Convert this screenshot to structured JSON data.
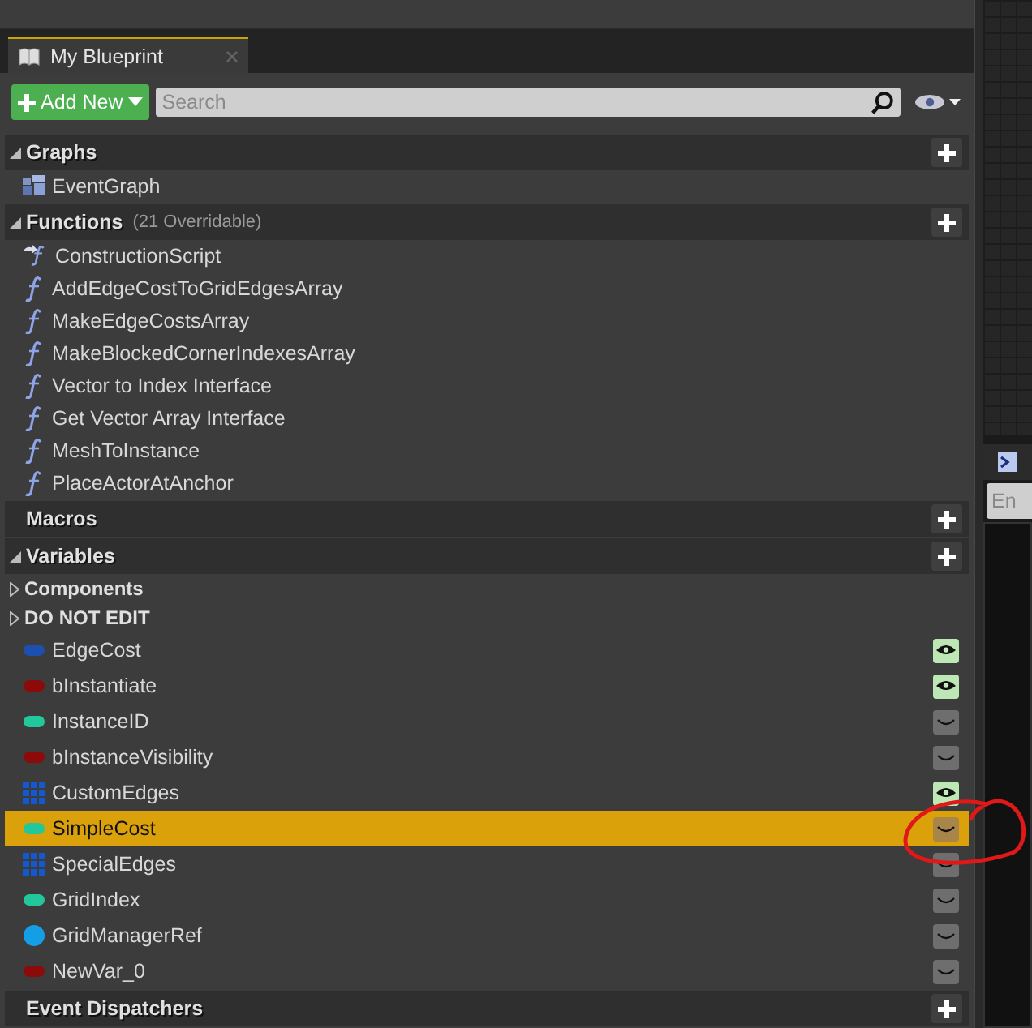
{
  "tab": {
    "title": "My Blueprint"
  },
  "toolbar": {
    "add_button": "Add New",
    "search": {
      "placeholder": "Search"
    }
  },
  "sections": [
    {
      "title": "Graphs",
      "expanded": true,
      "add_button": true,
      "items": [
        {
          "kind": "graph",
          "label": "EventGraph"
        }
      ]
    },
    {
      "title": "Functions",
      "note": "(21 Overridable)",
      "expanded": true,
      "add_button": true,
      "items": [
        {
          "kind": "construction",
          "label": "ConstructionScript"
        },
        {
          "kind": "function",
          "label": "AddEdgeCostToGridEdgesArray"
        },
        {
          "kind": "function",
          "label": "MakeEdgeCostsArray"
        },
        {
          "kind": "function",
          "label": "MakeBlockedCornerIndexesArray"
        },
        {
          "kind": "function",
          "label": "Vector to Index Interface"
        },
        {
          "kind": "function",
          "label": "Get Vector Array Interface"
        },
        {
          "kind": "function",
          "label": "MeshToInstance"
        },
        {
          "kind": "function",
          "label": "PlaceActorAtAnchor"
        }
      ]
    },
    {
      "title": "Macros",
      "expanded": false,
      "add_button": true
    },
    {
      "title": "Variables",
      "expanded": true,
      "add_button": true,
      "items": [
        {
          "kind": "category",
          "label": "Components",
          "expanded": false
        },
        {
          "kind": "category",
          "label": "DO NOT EDIT",
          "expanded": false
        },
        {
          "kind": "variable",
          "label": "EdgeCost",
          "color": "#1c4fae",
          "public": true,
          "selected": false
        },
        {
          "kind": "variable",
          "label": "bInstantiate",
          "color": "#8c0a0a",
          "public": true,
          "selected": false
        },
        {
          "kind": "variable",
          "label": "InstanceID",
          "color": "#22c89c",
          "public": false,
          "selected": false
        },
        {
          "kind": "variable",
          "label": "bInstanceVisibility",
          "color": "#8c0a0a",
          "public": false,
          "selected": false
        },
        {
          "kind": "array",
          "label": "CustomEdges",
          "color": "#1458d0",
          "public": true,
          "selected": false
        },
        {
          "kind": "variable",
          "label": "SimpleCost",
          "color": "#22c89c",
          "public": false,
          "selected": true
        },
        {
          "kind": "array",
          "label": "SpecialEdges",
          "color": "#1458d0",
          "public": false,
          "selected": false
        },
        {
          "kind": "variable",
          "label": "GridIndex",
          "color": "#22c89c",
          "public": false,
          "selected": false
        },
        {
          "kind": "object",
          "label": "GridManagerRef",
          "color": "#149ee6",
          "public": false,
          "selected": false
        },
        {
          "kind": "variable",
          "label": "NewVar_0",
          "color": "#8c0a0a",
          "public": false,
          "selected": false
        }
      ]
    },
    {
      "title": "Event Dispatchers",
      "expanded": false,
      "add_button": true
    }
  ],
  "side_panel": {
    "field": {
      "placeholder": "En"
    }
  }
}
